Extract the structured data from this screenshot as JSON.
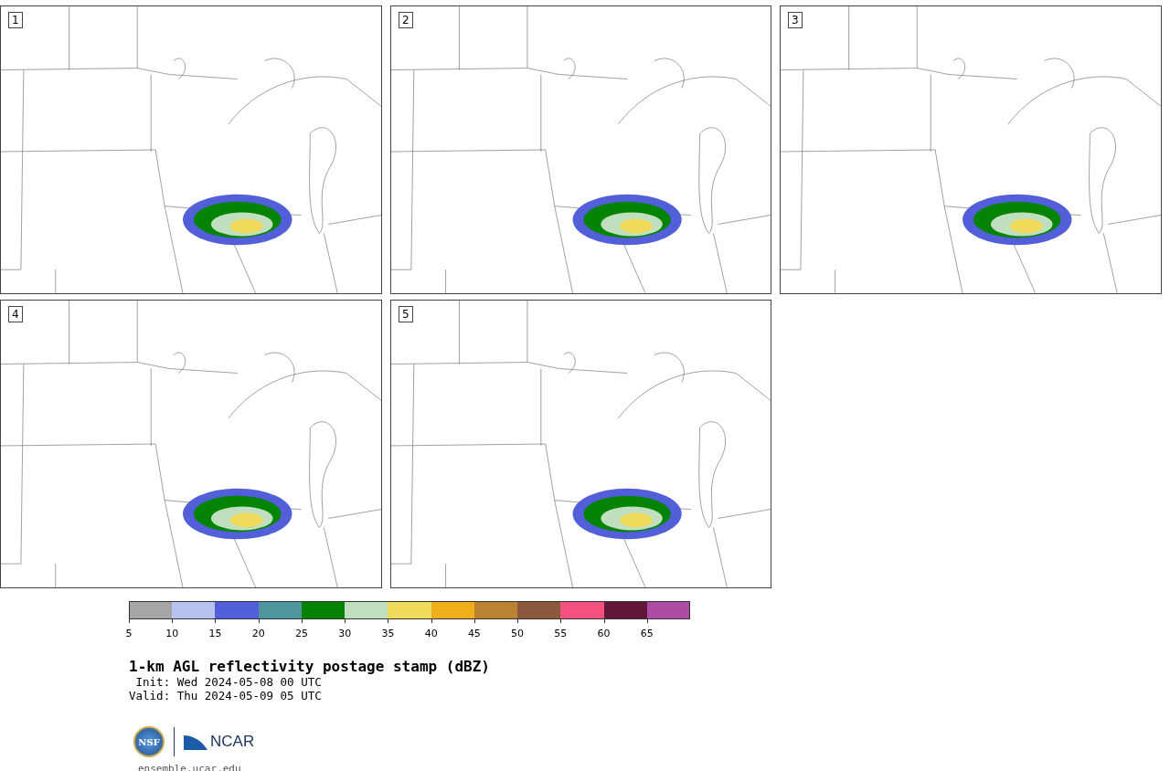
{
  "panels": [
    {
      "label": "1"
    },
    {
      "label": "2"
    },
    {
      "label": "3"
    },
    {
      "label": "4"
    },
    {
      "label": "5"
    }
  ],
  "colorbar": {
    "segments": [
      {
        "color": "#a5a5a5",
        "tick": "5"
      },
      {
        "color": "#b8c2ee",
        "tick": "10"
      },
      {
        "color": "#525fd8",
        "tick": "15"
      },
      {
        "color": "#4f969c",
        "tick": "20"
      },
      {
        "color": "#048402",
        "tick": "25"
      },
      {
        "color": "#bfdfbe",
        "tick": "30"
      },
      {
        "color": "#f0da5c",
        "tick": "35"
      },
      {
        "color": "#efaf18",
        "tick": "40"
      },
      {
        "color": "#ba8232",
        "tick": "45"
      },
      {
        "color": "#8b5a3e",
        "tick": "50"
      },
      {
        "color": "#f4517e",
        "tick": "55"
      },
      {
        "color": "#621738",
        "tick": "60"
      },
      {
        "color": "#ad4ba5",
        "tick": "65"
      }
    ]
  },
  "title": "1-km AGL reflectivity postage stamp (dBZ)",
  "init": " Init: Wed 2024-05-08 00 UTC",
  "valid": "Valid: Thu 2024-05-09 05 UTC",
  "logo": {
    "nsf": "NSF",
    "ncar": "NCAR"
  },
  "site": "ensemble.ucar.edu"
}
